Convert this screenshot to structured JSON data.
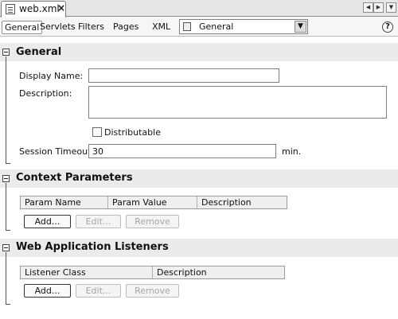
{
  "document_tab": {
    "label": "web.xml",
    "close": "×"
  },
  "nav": {
    "prev": "◀",
    "next": "▶",
    "menu": "▼"
  },
  "view_tabs": [
    "General",
    "Servlets",
    "Filters",
    "Pages",
    "XML"
  ],
  "view_combo": {
    "value": "General",
    "arrow": "▼"
  },
  "help": "?",
  "sections": {
    "general": {
      "title": "General",
      "display_name_label": "Display Name:",
      "display_name_value": "",
      "description_label": "Description:",
      "description_value": "",
      "distributable_label": "Distributable",
      "distributable_checked": false,
      "session_timeout_label": "Session Timeout:",
      "session_timeout_value": "30",
      "session_timeout_unit": "min."
    },
    "context_parameters": {
      "title": "Context Parameters",
      "columns": [
        "Param Name",
        "Param Value",
        "Description"
      ],
      "buttons": {
        "add": "Add...",
        "edit": "Edit...",
        "remove": "Remove"
      }
    },
    "listeners": {
      "title": "Web Application Listeners",
      "columns": [
        "Listener Class",
        "Description"
      ],
      "buttons": {
        "add": "Add...",
        "edit": "Edit...",
        "remove": "Remove"
      }
    }
  }
}
